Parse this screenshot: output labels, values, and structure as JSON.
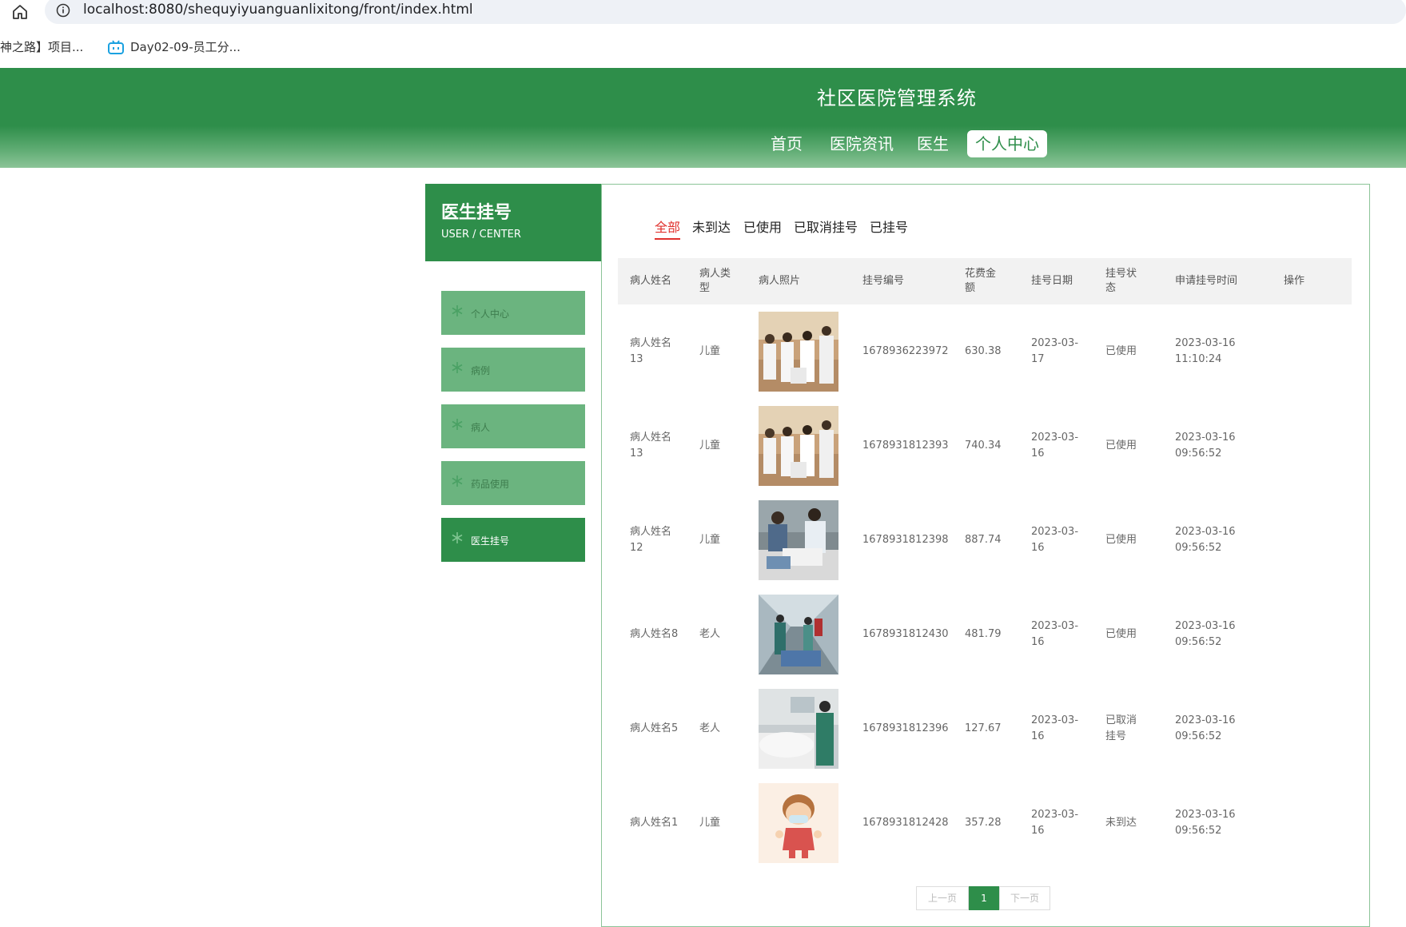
{
  "browser": {
    "url_host": "localhost",
    "url_rest": ":8080/shequyiyuanguanlixitong/front/index.html",
    "bookmarks": [
      "神之路】项目...",
      "Day02-09-员工分..."
    ]
  },
  "header": {
    "title": "社区医院管理系统",
    "nav": [
      "首页",
      "医院资讯",
      "医生",
      "个人中心"
    ],
    "active_nav": "个人中心"
  },
  "sidebar": {
    "title": "医生挂号",
    "subtitle": "USER / CENTER",
    "items": [
      {
        "label": "个人中心"
      },
      {
        "label": "病例"
      },
      {
        "label": "病人"
      },
      {
        "label": "药品使用"
      },
      {
        "label": "医生挂号"
      }
    ],
    "active": "医生挂号"
  },
  "tabs": [
    "全部",
    "未到达",
    "已使用",
    "已取消挂号",
    "已挂号"
  ],
  "active_tab": "全部",
  "table": {
    "headers": [
      "病人姓名",
      "病人类型",
      "病人照片",
      "挂号编号",
      "花费金额",
      "挂号日期",
      "挂号状态",
      "申请挂号时间",
      "操作"
    ],
    "rows": [
      {
        "name": "病人姓名13",
        "type": "儿童",
        "photo": "doctors-group-photo",
        "no": "1678936223972",
        "fee": "630.38",
        "date": "2023-03-17",
        "status": "已使用",
        "apply_time": "2023-03-16 11:10:24"
      },
      {
        "name": "病人姓名13",
        "type": "儿童",
        "photo": "doctors-group-photo",
        "no": "1678931812393",
        "fee": "740.34",
        "date": "2023-03-16",
        "status": "已使用",
        "apply_time": "2023-03-16 09:56:52"
      },
      {
        "name": "病人姓名12",
        "type": "儿童",
        "photo": "ward-care-photo",
        "no": "1678931812398",
        "fee": "887.74",
        "date": "2023-03-16",
        "status": "已使用",
        "apply_time": "2023-03-16 09:56:52"
      },
      {
        "name": "病人姓名8",
        "type": "老人",
        "photo": "corridor-stretcher-photo",
        "no": "1678931812430",
        "fee": "481.79",
        "date": "2023-03-16",
        "status": "已使用",
        "apply_time": "2023-03-16 09:56:52"
      },
      {
        "name": "病人姓名5",
        "type": "老人",
        "photo": "bedside-nurse-photo",
        "no": "1678931812396",
        "fee": "127.67",
        "date": "2023-03-16",
        "status": "已取消挂号",
        "apply_time": "2023-03-16 09:56:52"
      },
      {
        "name": "病人姓名1",
        "type": "儿童",
        "photo": "masked-child-cartoon",
        "no": "1678931812428",
        "fee": "357.28",
        "date": "2023-03-16",
        "status": "未到达",
        "apply_time": "2023-03-16 09:56:52"
      }
    ]
  },
  "pager": {
    "prev": "上一页",
    "current": "1",
    "next": "下一页"
  },
  "colors": {
    "brand_green": "#2e8e4a",
    "side_item_green": "#6bb47f",
    "active_tab_red": "#e0312d"
  }
}
